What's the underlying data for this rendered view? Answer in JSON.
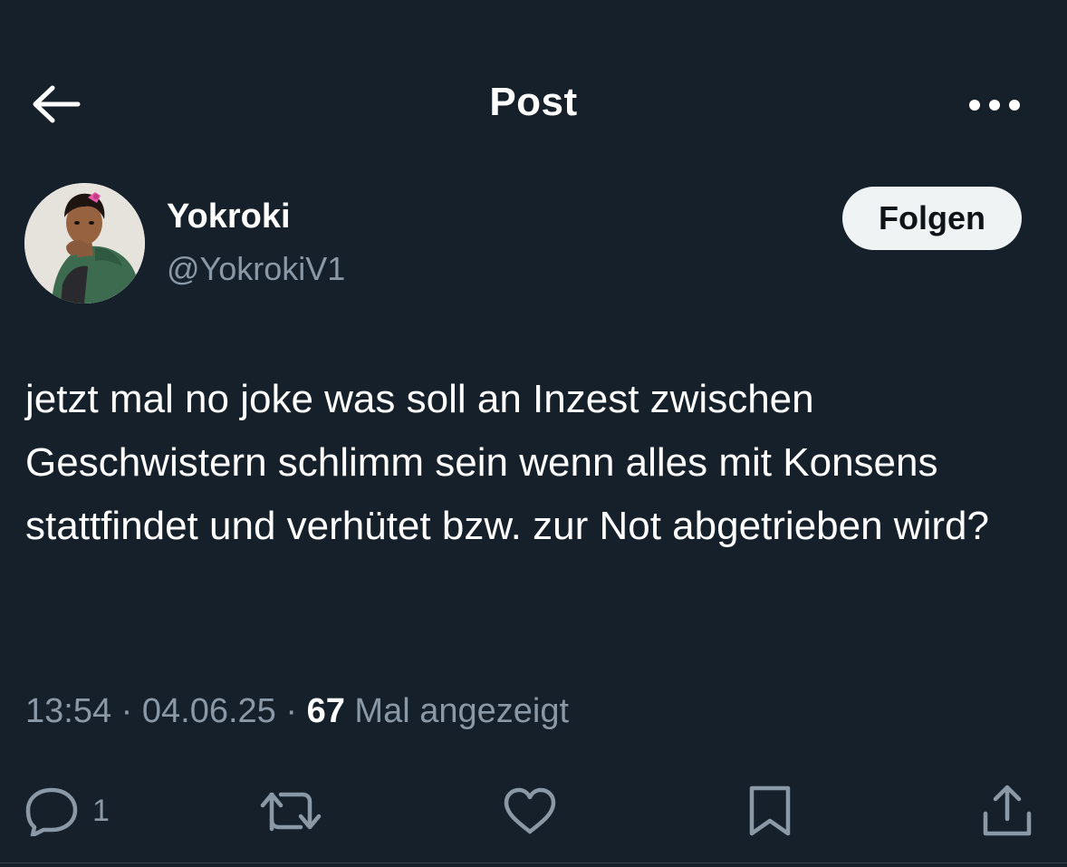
{
  "header": {
    "title": "Post",
    "back_icon": "arrow-left-icon",
    "more_icon": "more-horizontal-icon"
  },
  "author": {
    "display_name": "Yokroki",
    "handle": "@YokrokiV1",
    "follow_label": "Folgen"
  },
  "post": {
    "text": "jetzt mal no joke was soll an Inzest zwischen Geschwistern schlimm sein wenn alles mit Konsens stattfindet und verhütet bzw. zur Not abgetrieben wird?",
    "time": "13:54",
    "separator": "·",
    "date": "04.06.25",
    "views": "67",
    "views_label": "Mal angezeigt"
  },
  "actions": {
    "reply_count": "1",
    "icons": [
      "reply-icon",
      "repost-icon",
      "like-icon",
      "bookmark-icon",
      "share-icon"
    ]
  },
  "colors": {
    "background": "#15202b",
    "text_primary": "#ffffff",
    "text_secondary": "#8b98a5",
    "follow_button_bg": "#eff3f4"
  }
}
